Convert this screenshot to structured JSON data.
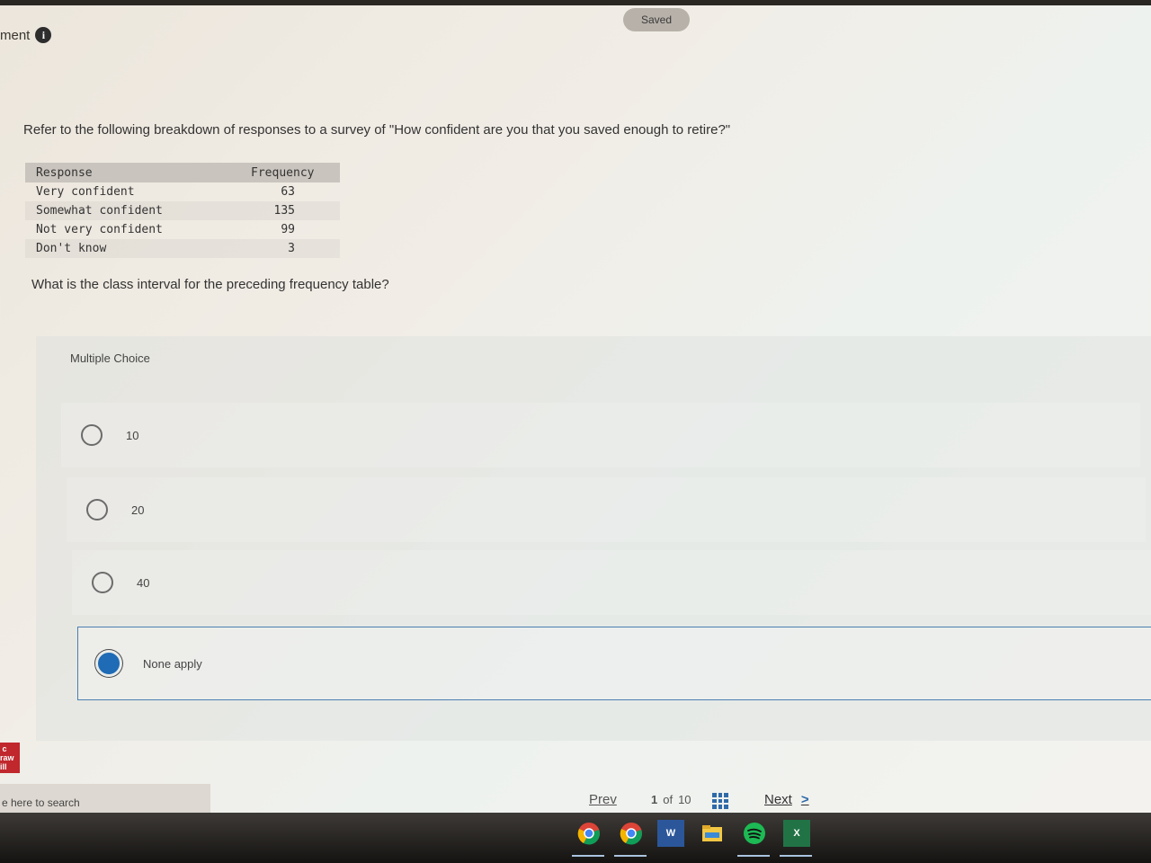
{
  "header": {
    "title_fragment": "ment",
    "saved_label": "Saved"
  },
  "question": {
    "prompt": "Refer to the following breakdown of responses to a survey of \"How confident are you that you saved enough to retire?\"",
    "table": {
      "headers": [
        "Response",
        "Frequency"
      ],
      "rows": [
        [
          "Very confident",
          "63"
        ],
        [
          "Somewhat confident",
          "135"
        ],
        [
          "Not very confident",
          "99"
        ],
        [
          "Don't know",
          "3"
        ]
      ]
    },
    "subquestion": "What is the class interval for the preceding frequency table?"
  },
  "multiple_choice": {
    "label": "Multiple Choice",
    "options": [
      {
        "label": "10",
        "selected": false
      },
      {
        "label": "20",
        "selected": false
      },
      {
        "label": "40",
        "selected": false
      },
      {
        "label": "None apply",
        "selected": true
      }
    ]
  },
  "footer": {
    "prev_label": "Prev",
    "current_page": "1",
    "of_label": "of",
    "total_pages": "10",
    "next_label": "Next",
    "brand_logo_text": "Mc Graw Hill"
  },
  "taskbar": {
    "search_placeholder": "e here to search",
    "apps": [
      "chrome-icon",
      "chrome-icon",
      "word-icon",
      "file-explorer-icon",
      "spotify-icon",
      "excel-icon"
    ]
  },
  "colors": {
    "accent": "#1f6bb5",
    "brand_red": "#c0282d"
  }
}
